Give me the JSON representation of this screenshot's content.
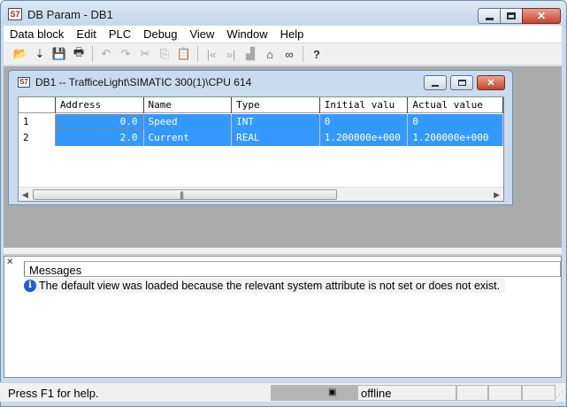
{
  "window": {
    "title": "DB Param - DB1",
    "icon": "step7-app-icon"
  },
  "menu": [
    "Data block",
    "Edit",
    "PLC",
    "Debug",
    "View",
    "Window",
    "Help"
  ],
  "toolbar": [
    {
      "icon": "open-folder-icon",
      "glyph": "📂",
      "enabled": true
    },
    {
      "icon": "download-icon",
      "glyph": "⇣",
      "enabled": true
    },
    {
      "icon": "save-icon",
      "glyph": "💾",
      "enabled": true
    },
    {
      "icon": "print-icon",
      "glyph": "🖶",
      "enabled": true
    },
    {
      "icon": "undo-icon",
      "glyph": "↶",
      "enabled": false
    },
    {
      "icon": "redo-icon",
      "glyph": "↷",
      "enabled": false
    },
    {
      "icon": "cut-icon",
      "glyph": "✂",
      "enabled": false
    },
    {
      "icon": "copy-icon",
      "glyph": "⎘",
      "enabled": false
    },
    {
      "icon": "paste-icon",
      "glyph": "📋",
      "enabled": false
    },
    {
      "icon": "go-first-icon",
      "glyph": "|«",
      "enabled": false
    },
    {
      "icon": "go-last-icon",
      "glyph": "»|",
      "enabled": false
    },
    {
      "icon": "monitor-icon",
      "glyph": "▟",
      "enabled": false
    },
    {
      "icon": "network-icon",
      "glyph": "⌂",
      "enabled": true
    },
    {
      "icon": "glasses-icon",
      "glyph": "∞",
      "enabled": true
    },
    {
      "icon": "whats-this-icon",
      "glyph": "?",
      "enabled": true
    }
  ],
  "child": {
    "title": "DB1 -- TrafficeLight\\SIMATIC 300(1)\\CPU 614",
    "columns": [
      "",
      "Address",
      "Name",
      "Type",
      "Initial valu",
      "Actual value"
    ],
    "rows": [
      {
        "index": "1",
        "address": "0.0",
        "name": "Speed",
        "type": "INT",
        "initial": "0",
        "actual": "0"
      },
      {
        "index": "2",
        "address": "2.0",
        "name": "Current",
        "type": "REAL",
        "initial": "1.200000e+000",
        "actual": "1.200000e+000"
      }
    ]
  },
  "messages": {
    "header": "Messages",
    "items": [
      {
        "icon": "info-icon",
        "text": "The default view was loaded because the relevant system attribute is not set or does not exist."
      }
    ]
  },
  "status": {
    "help": "Press F1 for help.",
    "connection": "offline"
  },
  "colors": {
    "selection": "#3399ff",
    "mdi_background": "#ababab",
    "frame": "#c9dcef"
  }
}
